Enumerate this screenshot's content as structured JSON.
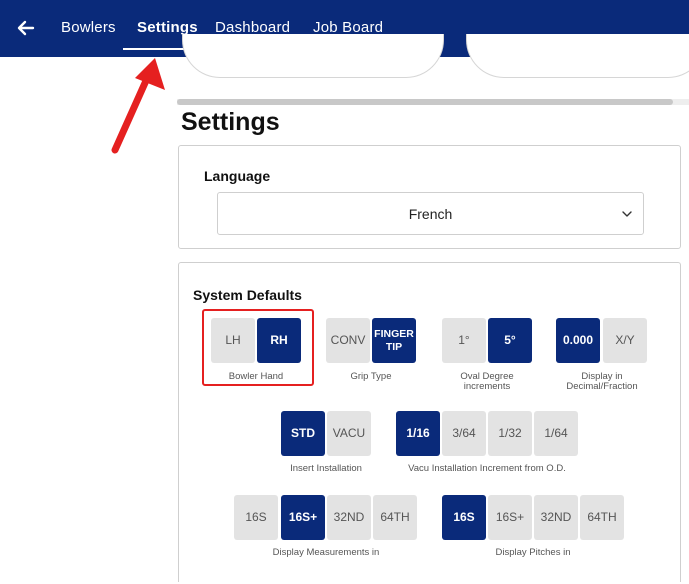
{
  "topbar": {
    "tabs": [
      {
        "label": "Bowlers"
      },
      {
        "label": "Settings"
      },
      {
        "label": "Dashboard"
      },
      {
        "label": "Job Board"
      }
    ],
    "active_tab": "Settings",
    "icons": {
      "back": "arrow-left-icon"
    }
  },
  "page": {
    "title": "Settings"
  },
  "language": {
    "label": "Language",
    "selected": "French",
    "icons": {
      "dropdown": "chevron-down-icon"
    }
  },
  "system_defaults": {
    "title": "System Defaults",
    "bowler_hand": {
      "options": [
        "LH",
        "RH"
      ],
      "selected": "RH",
      "caption": "Bowler Hand"
    },
    "grip_type": {
      "options": [
        "CONV",
        "FINGER TIP"
      ],
      "selected": "FINGER TIP",
      "caption": "Grip Type"
    },
    "oval_degree": {
      "options": [
        "1°",
        "5°"
      ],
      "selected": "5°",
      "caption_line1": "Oval Degree",
      "caption_line2": "increments"
    },
    "display_decimal": {
      "options": [
        "0.000",
        "X/Y"
      ],
      "selected": "0.000",
      "caption_line1": "Display in",
      "caption_line2": "Decimal/Fraction"
    },
    "insert_installation": {
      "options": [
        "STD",
        "VACU"
      ],
      "selected": "STD",
      "caption": "Insert Installation"
    },
    "vacu_increment": {
      "options": [
        "1/16",
        "3/64",
        "1/32",
        "1/64"
      ],
      "selected": "1/16",
      "caption": "Vacu Installation Increment from O.D."
    },
    "display_measurements": {
      "options": [
        "16S",
        "16S+",
        "32ND",
        "64TH"
      ],
      "selected": "16S+",
      "caption": "Display Measurements in"
    },
    "display_pitches": {
      "options": [
        "16S",
        "16S+",
        "32ND",
        "64TH"
      ],
      "selected": "16S",
      "caption": "Display Pitches in"
    }
  },
  "colors": {
    "brand_navy": "#0a2a7a",
    "option_inactive": "#e3e3e3",
    "annotation_red": "#e52020"
  }
}
